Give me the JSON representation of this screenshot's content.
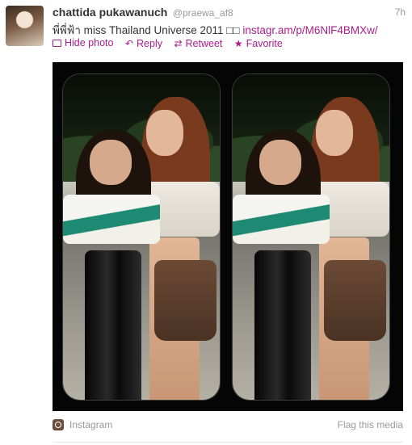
{
  "tweet": {
    "author_fullname": "chattida pukawanuch",
    "author_username": "@praewa_af8",
    "timestamp": "7h",
    "text": "พี่พี่ฟ้า miss Thailand Universe 2011 □□",
    "link": "instagr.am/p/M6NlF4BMXw/"
  },
  "actions": {
    "hide_photo": "Hide photo",
    "reply": "Reply",
    "retweet": "Retweet",
    "favorite": "Favorite"
  },
  "media": {
    "source": "Instagram",
    "flag": "Flag this media"
  },
  "colors": {
    "link": "#aa1e8c",
    "muted": "#999999",
    "text": "#333333"
  },
  "icons": {
    "hide_photo": "photo-frame-icon",
    "reply": "reply-arrow-icon",
    "retweet": "retweet-icon",
    "favorite": "star-icon",
    "source": "instagram-icon"
  }
}
